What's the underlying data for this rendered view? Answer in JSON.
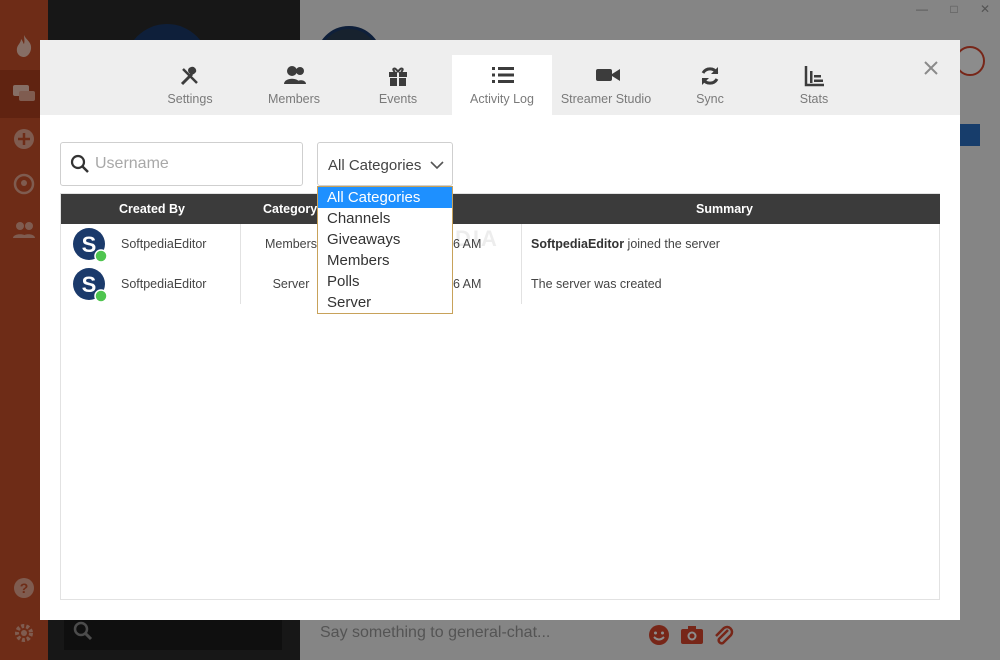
{
  "background": {
    "chat_input_placeholder": "Say something to general-chat..."
  },
  "modal": {
    "tabs": [
      {
        "label": "Settings",
        "icon": "tools-icon"
      },
      {
        "label": "Members",
        "icon": "members-icon"
      },
      {
        "label": "Events",
        "icon": "gift-icon"
      },
      {
        "label": "Activity Log",
        "icon": "list-icon",
        "active": true
      },
      {
        "label": "Streamer Studio",
        "icon": "video-camera-icon"
      },
      {
        "label": "Sync",
        "icon": "sync-icon"
      },
      {
        "label": "Stats",
        "icon": "chart-icon"
      }
    ],
    "filters": {
      "username_placeholder": "Username",
      "category_selected": "All Categories",
      "category_options": [
        "All Categories",
        "Channels",
        "Giveaways",
        "Members",
        "Polls",
        "Server"
      ]
    },
    "table": {
      "headers": {
        "created_by": "Created By",
        "category": "Category",
        "summary": "Summary"
      },
      "rows": [
        {
          "created_by": "SoftpediaEditor",
          "category": "Members",
          "date": "06 AM",
          "summary_bold": "SoftpediaEditor",
          "summary_rest": " joined the server"
        },
        {
          "created_by": "SoftpediaEditor",
          "category": "Server",
          "date": "06 AM",
          "summary_bold": "",
          "summary_rest": "The server was created"
        }
      ]
    },
    "watermark": "SOFTPEDIA"
  },
  "colors": {
    "brand": "#c9502a",
    "selected": "#1e90ff",
    "header_bg": "#3b3b3b",
    "online": "#4fc54f"
  }
}
